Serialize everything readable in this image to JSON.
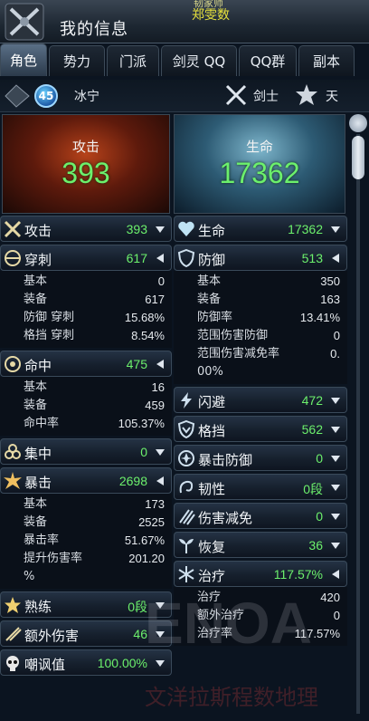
{
  "window": {
    "title": "我的信息",
    "top_name_partial": "韧家师",
    "player_name": "郑雯数"
  },
  "tabs": [
    {
      "label": "角色",
      "active": true
    },
    {
      "label": "势力",
      "active": false
    },
    {
      "label": "门派",
      "active": false
    },
    {
      "label": "剑灵 QQ",
      "active": false
    },
    {
      "label": "QQ群",
      "active": false
    },
    {
      "label": "副本",
      "active": false
    }
  ],
  "character": {
    "level": "45",
    "name": "冰宁",
    "class_name": "剑士",
    "faction_name": "天"
  },
  "summary": {
    "attack_label": "攻击",
    "attack_value": "393",
    "life_label": "生命",
    "life_value": "17362"
  },
  "left": {
    "attack": {
      "name": "攻击",
      "value": "393"
    },
    "pierce": {
      "name": "穿刺",
      "value": "617",
      "rows": [
        {
          "k": "基本",
          "v": "0"
        },
        {
          "k": "装备",
          "v": "617"
        },
        {
          "k": "防御 穿刺",
          "v": "15.68%"
        },
        {
          "k": "格挡 穿刺",
          "v": "8.54%"
        }
      ]
    },
    "accuracy": {
      "name": "命中",
      "value": "475",
      "rows": [
        {
          "k": "基本",
          "v": "16"
        },
        {
          "k": "装备",
          "v": "459"
        },
        {
          "k": "命中率",
          "v": "105.37%"
        }
      ]
    },
    "focus": {
      "name": "集中",
      "value": "0"
    },
    "critical": {
      "name": "暴击",
      "value": "2698",
      "rows": [
        {
          "k": "基本",
          "v": "173"
        },
        {
          "k": "装备",
          "v": "2525"
        },
        {
          "k": "暴击率",
          "v": "51.67%"
        },
        {
          "k": "提升伤害率",
          "v": "201.20"
        }
      ],
      "wrap": "%"
    },
    "mastery": {
      "name": "熟练",
      "value": "0段"
    },
    "extra_damage": {
      "name": "额外伤害",
      "value": "46"
    },
    "threat": {
      "name": "嘲讽值",
      "value": "100.00%"
    }
  },
  "right": {
    "life": {
      "name": "生命",
      "value": "17362"
    },
    "defense": {
      "name": "防御",
      "value": "513",
      "rows": [
        {
          "k": "基本",
          "v": "350"
        },
        {
          "k": "装备",
          "v": "163"
        },
        {
          "k": "防御率",
          "v": "13.41%"
        },
        {
          "k": "范围伤害防御",
          "v": "0"
        },
        {
          "k": "范围伤害减免率",
          "v": "0."
        }
      ],
      "wrap": "00%"
    },
    "evasion": {
      "name": "闪避",
      "value": "472"
    },
    "block": {
      "name": "格挡",
      "value": "562"
    },
    "crit_defense": {
      "name": "暴击防御",
      "value": "0"
    },
    "tenacity": {
      "name": "韧性",
      "value": "0段"
    },
    "damage_reduction": {
      "name": "伤害减免",
      "value": "0"
    },
    "recovery": {
      "name": "恢复",
      "value": "36"
    },
    "healing": {
      "name": "治疗",
      "value": "117.57%",
      "rows": [
        {
          "k": "治疗",
          "v": "420"
        },
        {
          "k": "额外治疗",
          "v": "0"
        },
        {
          "k": "治疗率",
          "v": "117.57%"
        }
      ]
    }
  },
  "watermark": {
    "text": "文洋拉斯程数地理"
  },
  "colors": {
    "value_green": "#6cf06c",
    "title_yellow": "#e8e23c"
  }
}
